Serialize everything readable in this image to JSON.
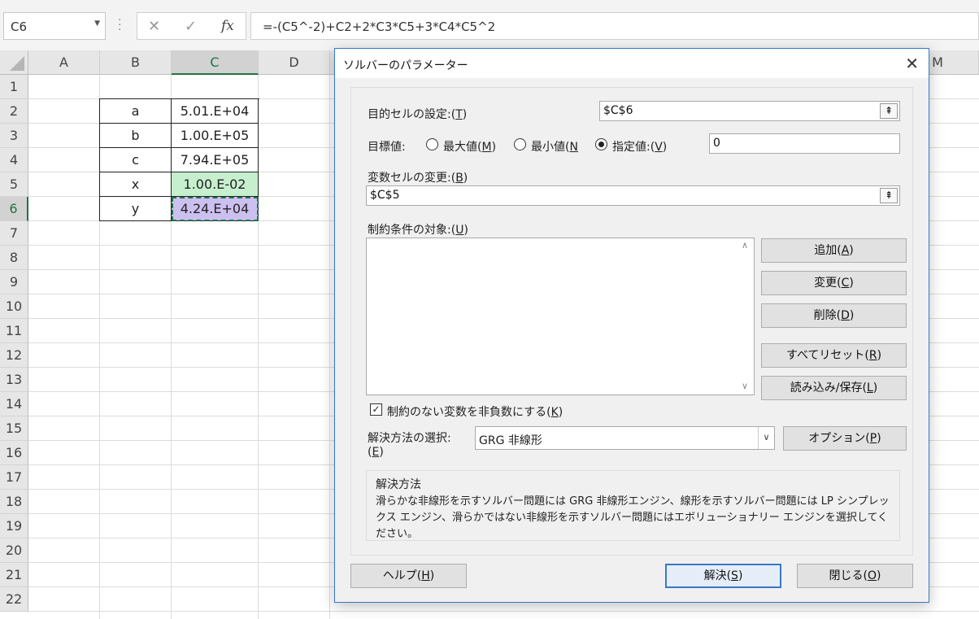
{
  "formula_bar": {
    "name_box": "C6",
    "cancel_icon": "✕",
    "enter_icon": "✓",
    "fx_label": "fx",
    "formula": "=-(C5^-2)+C2+2*C3*C5+3*C4*C5^2"
  },
  "sheet": {
    "columns": [
      "A",
      "B",
      "C",
      "D",
      "M"
    ],
    "rows": [
      "1",
      "2",
      "3",
      "4",
      "5",
      "6",
      "7",
      "8",
      "9",
      "10",
      "11",
      "12",
      "13",
      "14",
      "15",
      "16",
      "17",
      "18",
      "19",
      "20",
      "21",
      "22"
    ],
    "table": [
      {
        "label": "a",
        "value": "5.01.E+04"
      },
      {
        "label": "b",
        "value": "1.00.E+05"
      },
      {
        "label": "c",
        "value": "7.94.E+05"
      },
      {
        "label": "x",
        "value": "1.00.E-02"
      },
      {
        "label": "y",
        "value": "4.24.E+04"
      }
    ],
    "colors": {
      "x_fill": "#c6efce",
      "y_fill": "#ccc0f0",
      "accent": "#217346"
    }
  },
  "dialog": {
    "title": "ソルバーのパラメーター",
    "objective_label": "目的セルの設定:(",
    "objective_key": "T",
    "objective_value": "$C$6",
    "target_label": "目標値:",
    "opt_max": "最大値(",
    "opt_max_key": "M",
    "opt_min": "最小値(",
    "opt_min_key": "N",
    "opt_value": "指定値:(",
    "opt_value_key": "V",
    "target_value": "0",
    "changing_label": "変数セルの変更:(",
    "changing_key": "B",
    "changing_value": "$C$5",
    "constraints_label": "制約条件の対象:(",
    "constraints_key": "U",
    "buttons": {
      "add": "追加(",
      "add_key": "A",
      "change": "変更(",
      "change_key": "C",
      "delete": "削除(",
      "delete_key": "D",
      "reset": "すべてリセット(",
      "reset_key": "R",
      "load_save": "読み込み/保存(",
      "load_save_key": "L",
      "options": "オプション(",
      "options_key": "P",
      "help": "ヘルプ(",
      "help_key": "H",
      "solve": "解決(",
      "solve_key": "S",
      "close": "閉じる(",
      "close_key": "O"
    },
    "nonneg_label": "制約のない変数を非負数にする(",
    "nonneg_key": "K",
    "method_label_1": "解決方法の選択:",
    "method_label_2_key": "E",
    "method_value": "GRG 非線形",
    "method_group_title": "解決方法",
    "method_desc": "滑らかな非線形を示すソルバー問題には GRG 非線形エンジン、線形を示すソルバー問題には LP シンプレックス エンジン、滑らかではない非線形を示すソルバー問題にはエボリューショナリー エンジンを選択してください。"
  }
}
